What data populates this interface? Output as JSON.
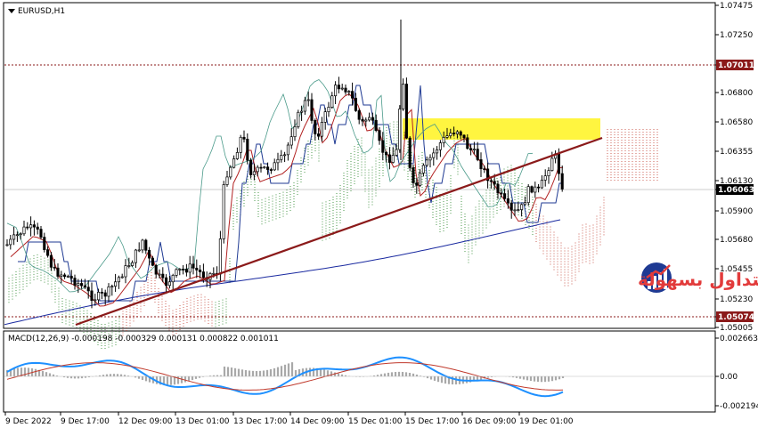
{
  "chart_title": "EURUSD,H1",
  "chart_menu_icon": "triangle-down-icon",
  "price_scale": {
    "labels": [
      "1.07475",
      "1.07250",
      "1.07011",
      "1.06800",
      "1.06580",
      "1.06355",
      "1.06130",
      "1.06063",
      "1.05900",
      "1.05680",
      "1.05455",
      "1.05230",
      "1.05074",
      "1.05005"
    ],
    "highlighted": [
      {
        "value": "1.07011",
        "color": "#8b1a1a"
      },
      {
        "value": "1.06063",
        "color": "#000000"
      },
      {
        "value": "1.05074",
        "color": "#8b1a1a"
      }
    ]
  },
  "macd": {
    "label": "MACD(12,26,9) -0.000198 -0.000329 0.000131 0.000822 0.001011",
    "scale": [
      "0.002663",
      "0.00",
      "-0.002194"
    ]
  },
  "time_axis": [
    "9 Dec 2022",
    "9 Dec 17:00",
    "12 Dec 09:00",
    "13 Dec 01:00",
    "13 Dec 17:00",
    "14 Dec 09:00",
    "15 Dec 01:00",
    "15 Dec 17:00",
    "16 Dec 09:00",
    "19 Dec 01:00"
  ],
  "logo": {
    "text": "التداول بسهولة",
    "icon": "bar-chart-logo-icon"
  },
  "colors": {
    "up_candle": "#000000",
    "tenkan": "#b22222",
    "kijun": "#1f3a93",
    "senkou_a": "#1e7f1e",
    "senkou_b": "#c0392b",
    "trendline": "#8b1a1a",
    "zone": "#fff200",
    "ma": "#1a2aa0",
    "macd_line": "#1e90ff",
    "signal_line": "#c0392b",
    "histogram": "#a9a9a9"
  }
}
